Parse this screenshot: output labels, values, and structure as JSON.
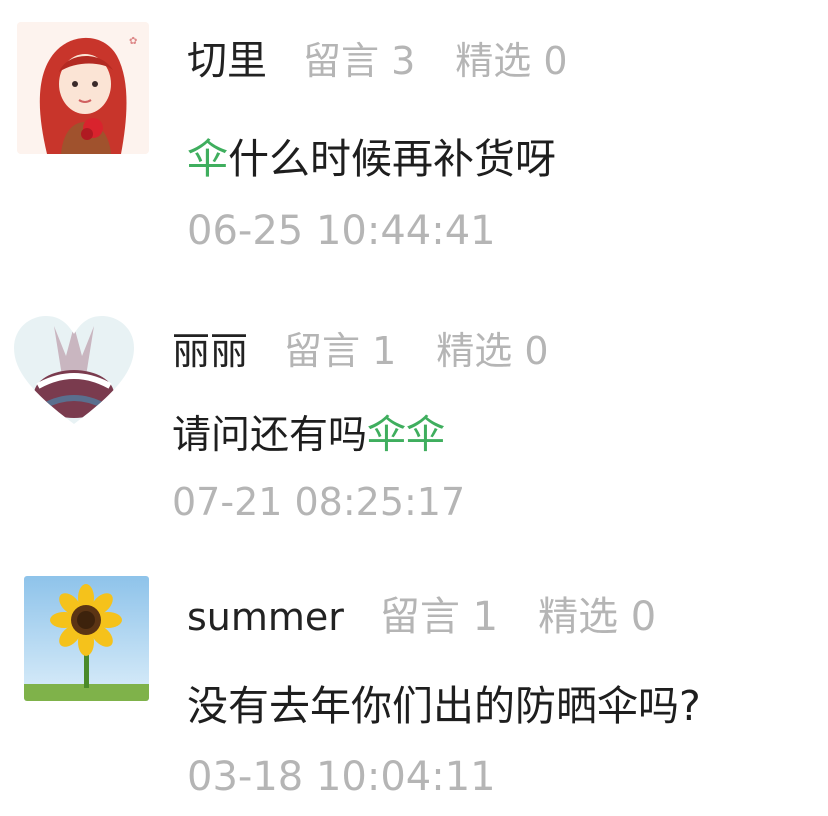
{
  "comments": [
    {
      "name": "切里",
      "replies_label": "留言 3",
      "featured_label": "精选 0",
      "text_parts": [
        "伞",
        "什么时候再补货呀"
      ],
      "time": "06-25 10:44:41",
      "avatar_icon": "red-haired-girl-avatar"
    },
    {
      "name": "丽丽",
      "replies_label": "留言 1",
      "featured_label": "精选 0",
      "text_parts": [
        "请问还有吗",
        "伞伞"
      ],
      "time": "07-21 08:25:17",
      "avatar_icon": "heart-shaped-photo-avatar"
    },
    {
      "name": "summer",
      "replies_label": "留言 1",
      "featured_label": "精选 0",
      "text_parts": [
        "没有去年你们出的防晒伞吗?"
      ],
      "time": "03-18 10:04:11",
      "avatar_icon": "sunflower-avatar"
    }
  ],
  "colors": {
    "highlight": "#3fae5e",
    "meta": "#b5b5b5",
    "text": "#1e1e1e"
  }
}
